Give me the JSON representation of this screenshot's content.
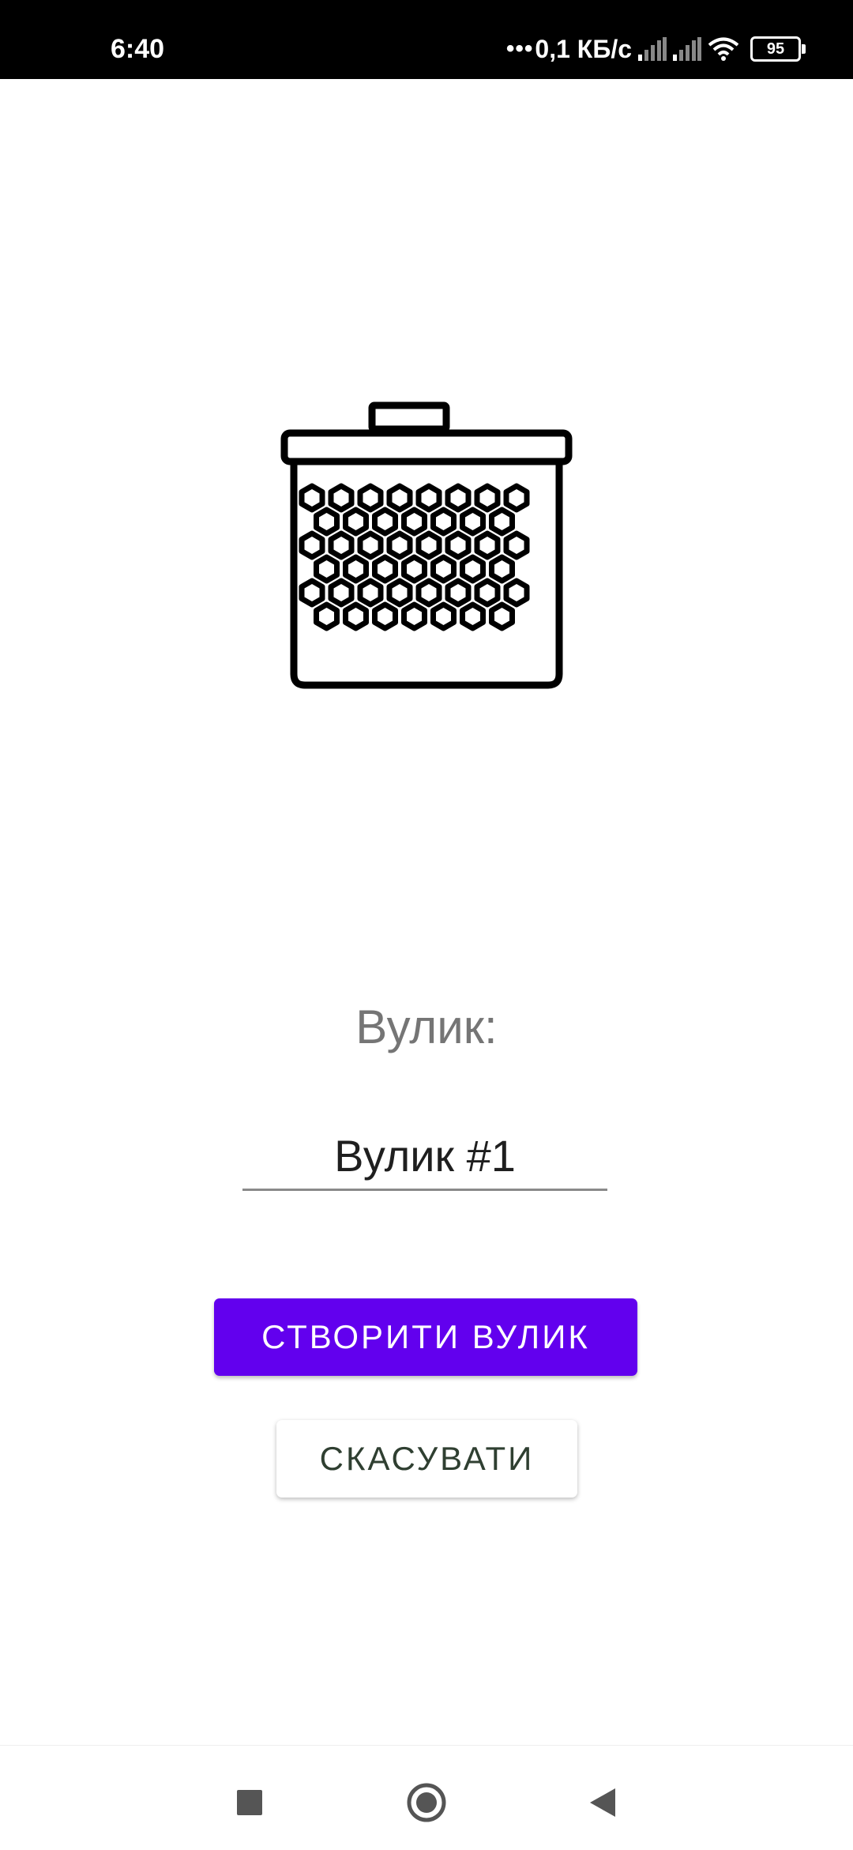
{
  "status_bar": {
    "time": "6:40",
    "dots": "•••",
    "network_speed": "0,1 КБ/с",
    "battery_level": "95"
  },
  "main": {
    "hive_icon": "beehive-honeycomb-icon",
    "label": "Вулик:",
    "name_field_value": "Вулик #1",
    "create_button_label": "СТВОРИТИ ВУЛИК",
    "cancel_button_label": "СКАСУВАТИ"
  },
  "colors": {
    "accent": "#6200ee",
    "label_gray": "#757575",
    "cancel_text": "#2f3f31"
  },
  "nav_bar": {
    "icons": [
      "recents-icon",
      "home-icon",
      "back-icon"
    ]
  }
}
